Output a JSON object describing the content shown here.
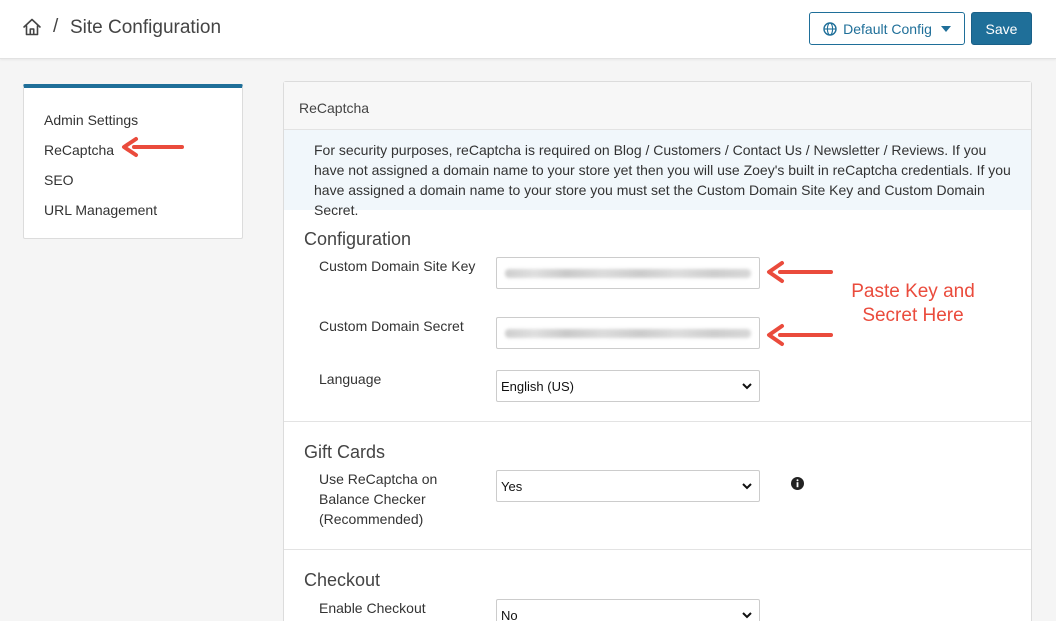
{
  "header": {
    "separator": "/",
    "title": "Site Configuration",
    "config_button": "Default Config",
    "save_button": "Save"
  },
  "sidebar": {
    "items": [
      {
        "label": "Admin Settings"
      },
      {
        "label": "ReCaptcha"
      },
      {
        "label": "SEO"
      },
      {
        "label": "URL Management"
      }
    ]
  },
  "panel": {
    "title": "ReCaptcha",
    "info": "For security purposes, reCaptcha is required on Blog / Customers / Contact Us / Newsletter / Reviews. If you have not assigned a domain name to your store yet then you will use Zoey's built in reCaptcha credentials. If you have assigned a domain name to your store you must set the Custom Domain Site Key and Custom Domain Secret.",
    "configuration": {
      "title": "Configuration",
      "site_key_label": "Custom Domain Site Key",
      "secret_label": "Custom Domain Secret",
      "language_label": "Language",
      "language_value": "English (US)"
    },
    "gift_cards": {
      "title": "Gift Cards",
      "balance_label": "Use ReCaptcha on Balance Checker (Recommended)",
      "balance_value": "Yes"
    },
    "checkout": {
      "title": "Checkout",
      "enable_label": "Enable Checkout",
      "enable_value": "No"
    }
  },
  "annotation": {
    "line1": "Paste Key and",
    "line2": "Secret Here",
    "color": "#ea4b3c"
  },
  "colors": {
    "accent": "#1f6f99",
    "info_background": "#f1f7fb"
  }
}
